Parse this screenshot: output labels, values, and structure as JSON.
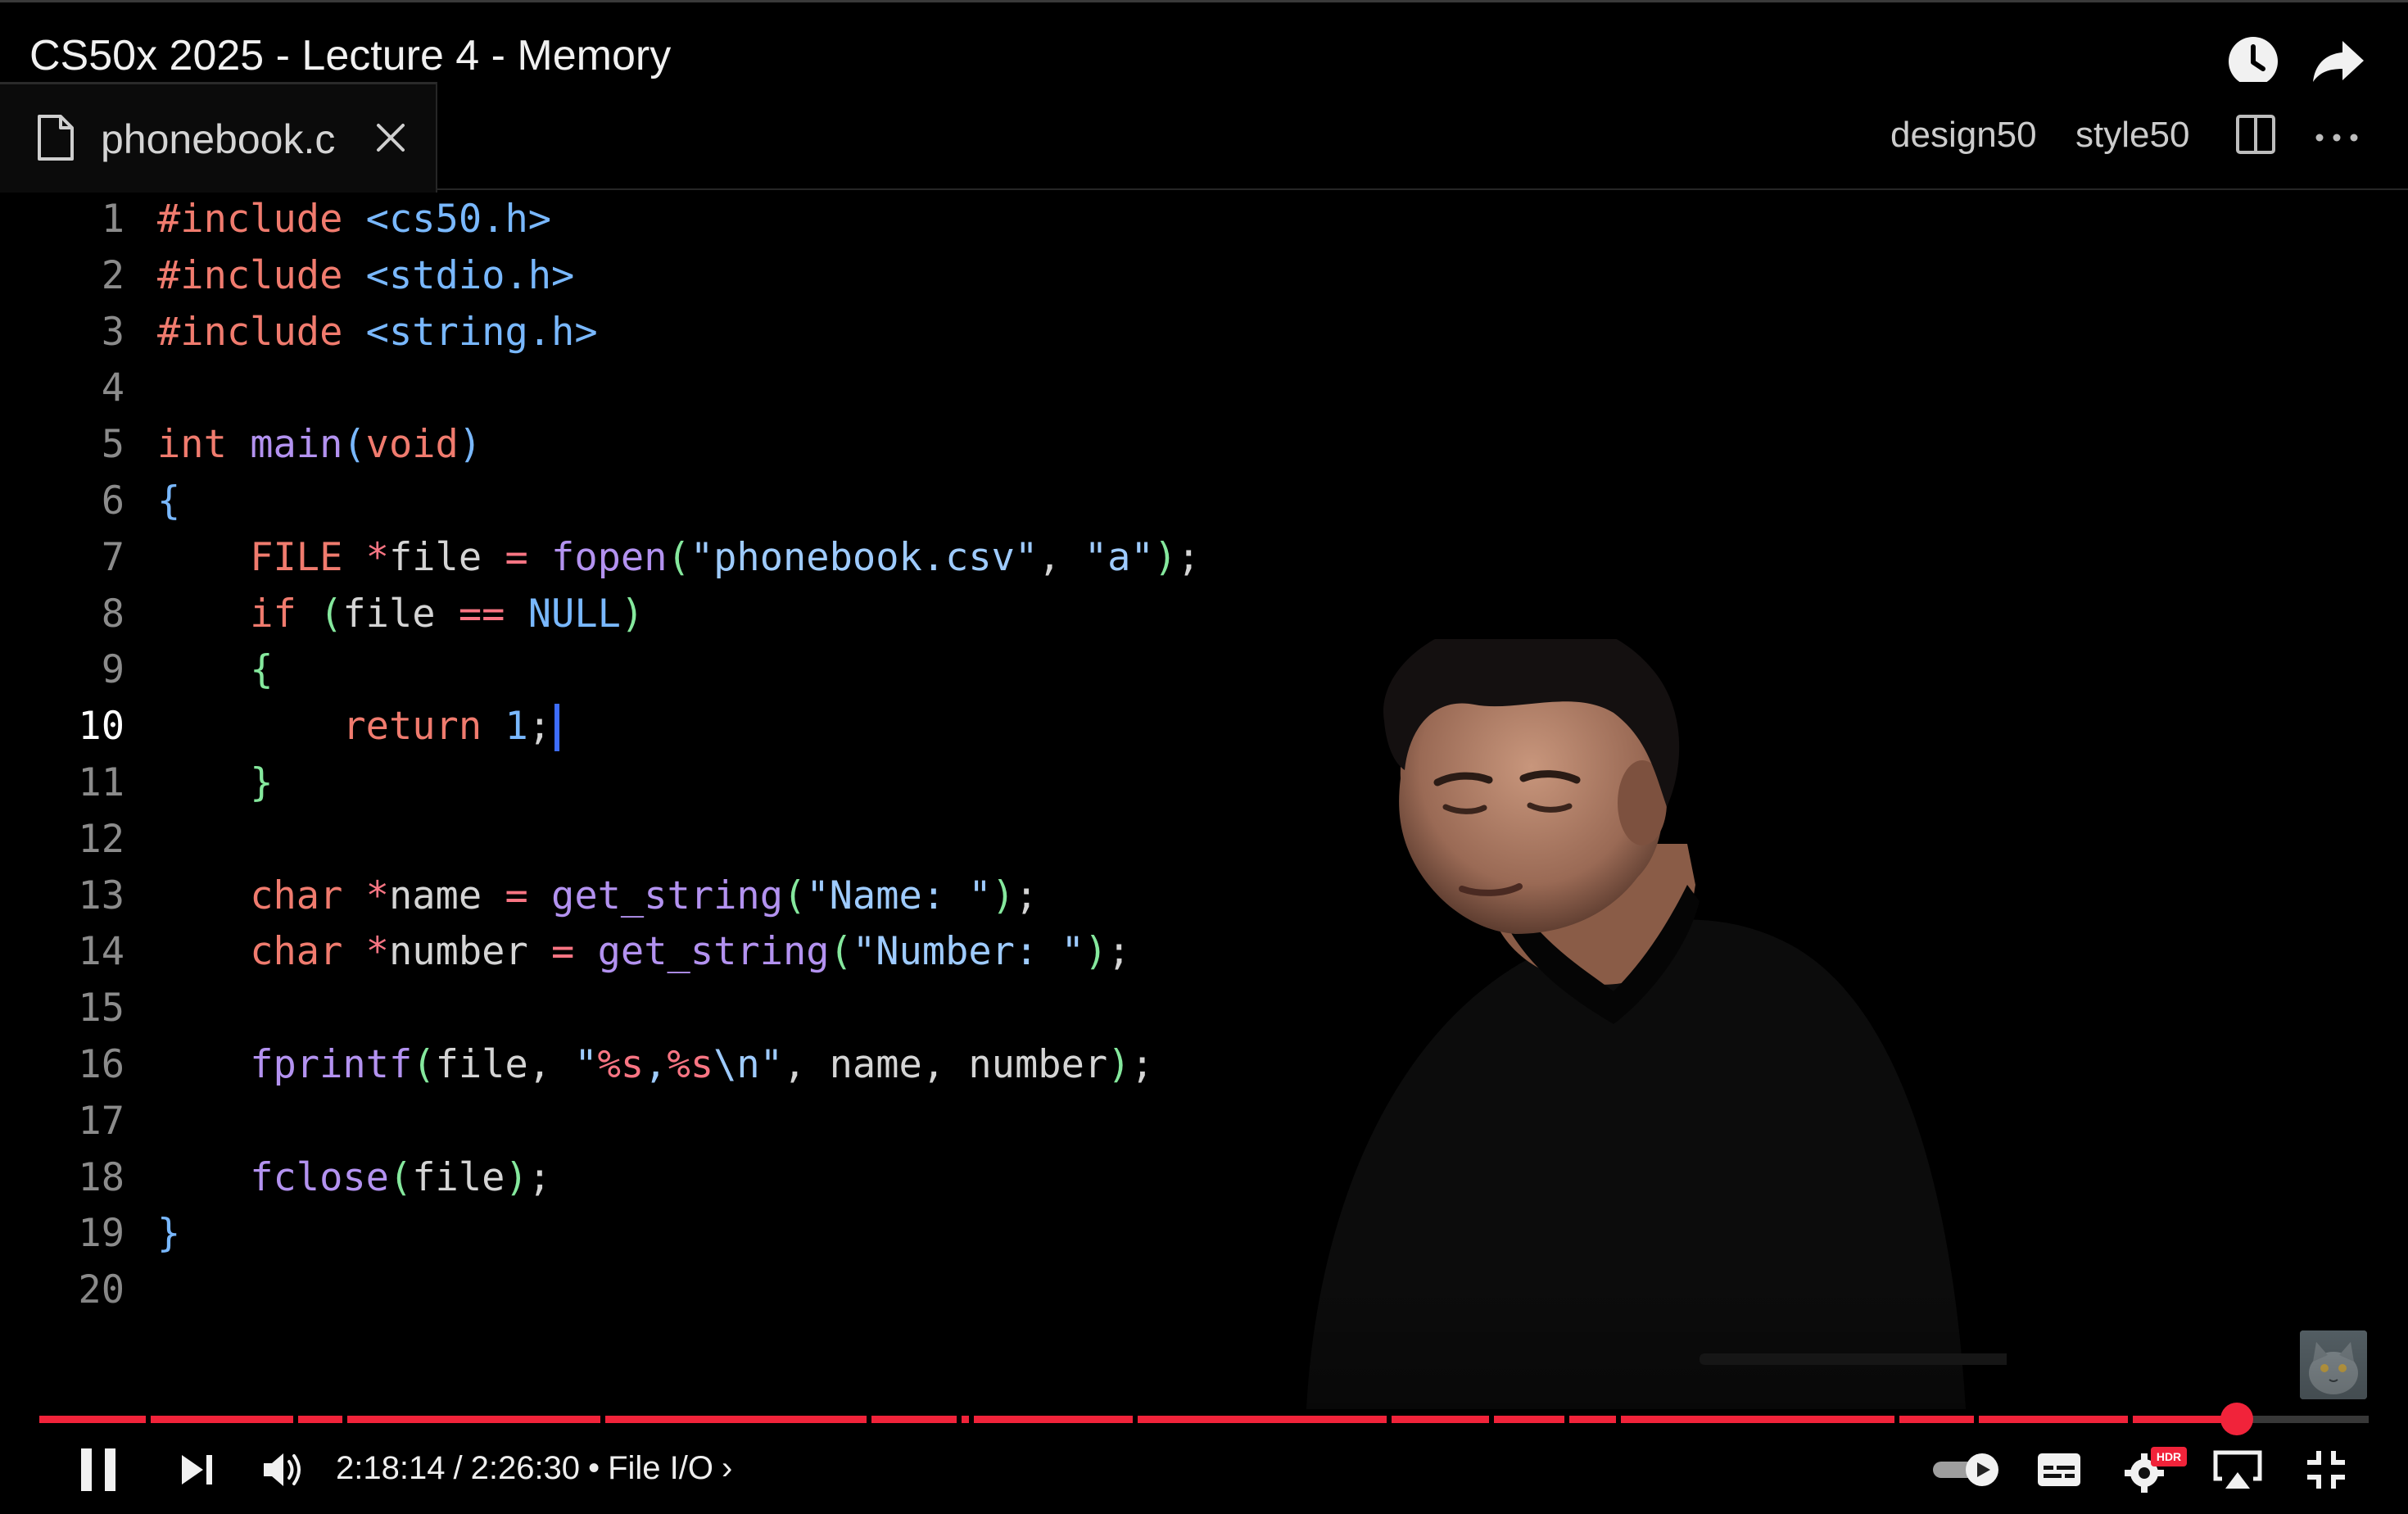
{
  "video": {
    "title": "CS50x 2025 - Lecture 4 - Memory",
    "top_icons": [
      "watch-later-icon",
      "share-icon"
    ]
  },
  "editor": {
    "tab_label": "phonebook.c",
    "actions": [
      "design50",
      "style50"
    ],
    "active_line": 10,
    "lines": [
      {
        "n": "1",
        "html": "<span class=\"kw\">#include</span> <span class=\"incl\">&lt;cs50.h&gt;</span>"
      },
      {
        "n": "2",
        "html": "<span class=\"kw\">#include</span> <span class=\"incl\">&lt;stdio.h&gt;</span>"
      },
      {
        "n": "3",
        "html": "<span class=\"kw\">#include</span> <span class=\"incl\">&lt;string.h&gt;</span>"
      },
      {
        "n": "4",
        "html": ""
      },
      {
        "n": "5",
        "html": "<span class=\"kw\">int</span> <span class=\"fn\">main</span><span class=\"br1\">(</span><span class=\"kw\">void</span><span class=\"br1\">)</span>"
      },
      {
        "n": "6",
        "html": "<span class=\"br1\">{</span>"
      },
      {
        "n": "7",
        "html": "    <span class=\"kw\">FILE</span> <span class=\"op\">*</span>file <span class=\"op\">=</span> <span class=\"fn\">fopen</span><span class=\"br2\">(</span><span class=\"str\">\"phonebook.csv\"</span>, <span class=\"str\">\"a\"</span><span class=\"br2\">)</span>;"
      },
      {
        "n": "8",
        "html": "    <span class=\"kw\">if</span> <span class=\"br2\">(</span>file <span class=\"op\">==</span> <span class=\"num\">NULL</span><span class=\"br2\">)</span>"
      },
      {
        "n": "9",
        "html": "    <span class=\"br2\">{</span>"
      },
      {
        "n": "10",
        "html": "        <span class=\"kw\">return</span> <span class=\"num\">1</span>;"
      },
      {
        "n": "11",
        "html": "    <span class=\"br2\">}</span>"
      },
      {
        "n": "12",
        "html": ""
      },
      {
        "n": "13",
        "html": "    <span class=\"kw\">char</span> <span class=\"op\">*</span>name <span class=\"op\">=</span> <span class=\"fn\">get_string</span><span class=\"br2\">(</span><span class=\"str\">\"Name: \"</span><span class=\"br2\">)</span>;"
      },
      {
        "n": "14",
        "html": "    <span class=\"kw\">char</span> <span class=\"op\">*</span>number <span class=\"op\">=</span> <span class=\"fn\">get_string</span><span class=\"br2\">(</span><span class=\"str\">\"Number: \"</span><span class=\"br2\">)</span>;"
      },
      {
        "n": "15",
        "html": ""
      },
      {
        "n": "16",
        "html": "    <span class=\"fn\">fprintf</span><span class=\"br2\">(</span>file, <span class=\"str\">\"<span class=\"fmt\">%s</span>,<span class=\"fmt\">%s</span>\\n\"</span>, name, number<span class=\"br2\">)</span>;"
      },
      {
        "n": "17",
        "html": ""
      },
      {
        "n": "18",
        "html": "    <span class=\"fn\">fclose</span><span class=\"br2\">(</span>file<span class=\"br2\">)</span>;"
      },
      {
        "n": "19",
        "html": "<span class=\"br1\">}</span>"
      },
      {
        "n": "20",
        "html": ""
      }
    ]
  },
  "player": {
    "current_time": "2:18:14",
    "duration": "2:26:30",
    "time_separator": "/",
    "bullet": "•",
    "chapter": "File I/O",
    "chapter_chevron": "›",
    "progress_fraction": 0.9435,
    "hdr_badge": "HDR",
    "controls": [
      "pause-icon",
      "next-icon",
      "volume-icon",
      "autoplay-toggle-icon",
      "subtitles-icon",
      "settings-hdr-icon",
      "airplay-icon",
      "exit-fullscreen-icon"
    ],
    "accent_color": "#f1233a"
  },
  "colors": {
    "keyword": "#f07b6e",
    "function": "#b392f0",
    "string": "#9ecbff",
    "operator": "#f97583",
    "bracket_outer": "#79b8ff",
    "bracket_inner": "#85e89d"
  }
}
